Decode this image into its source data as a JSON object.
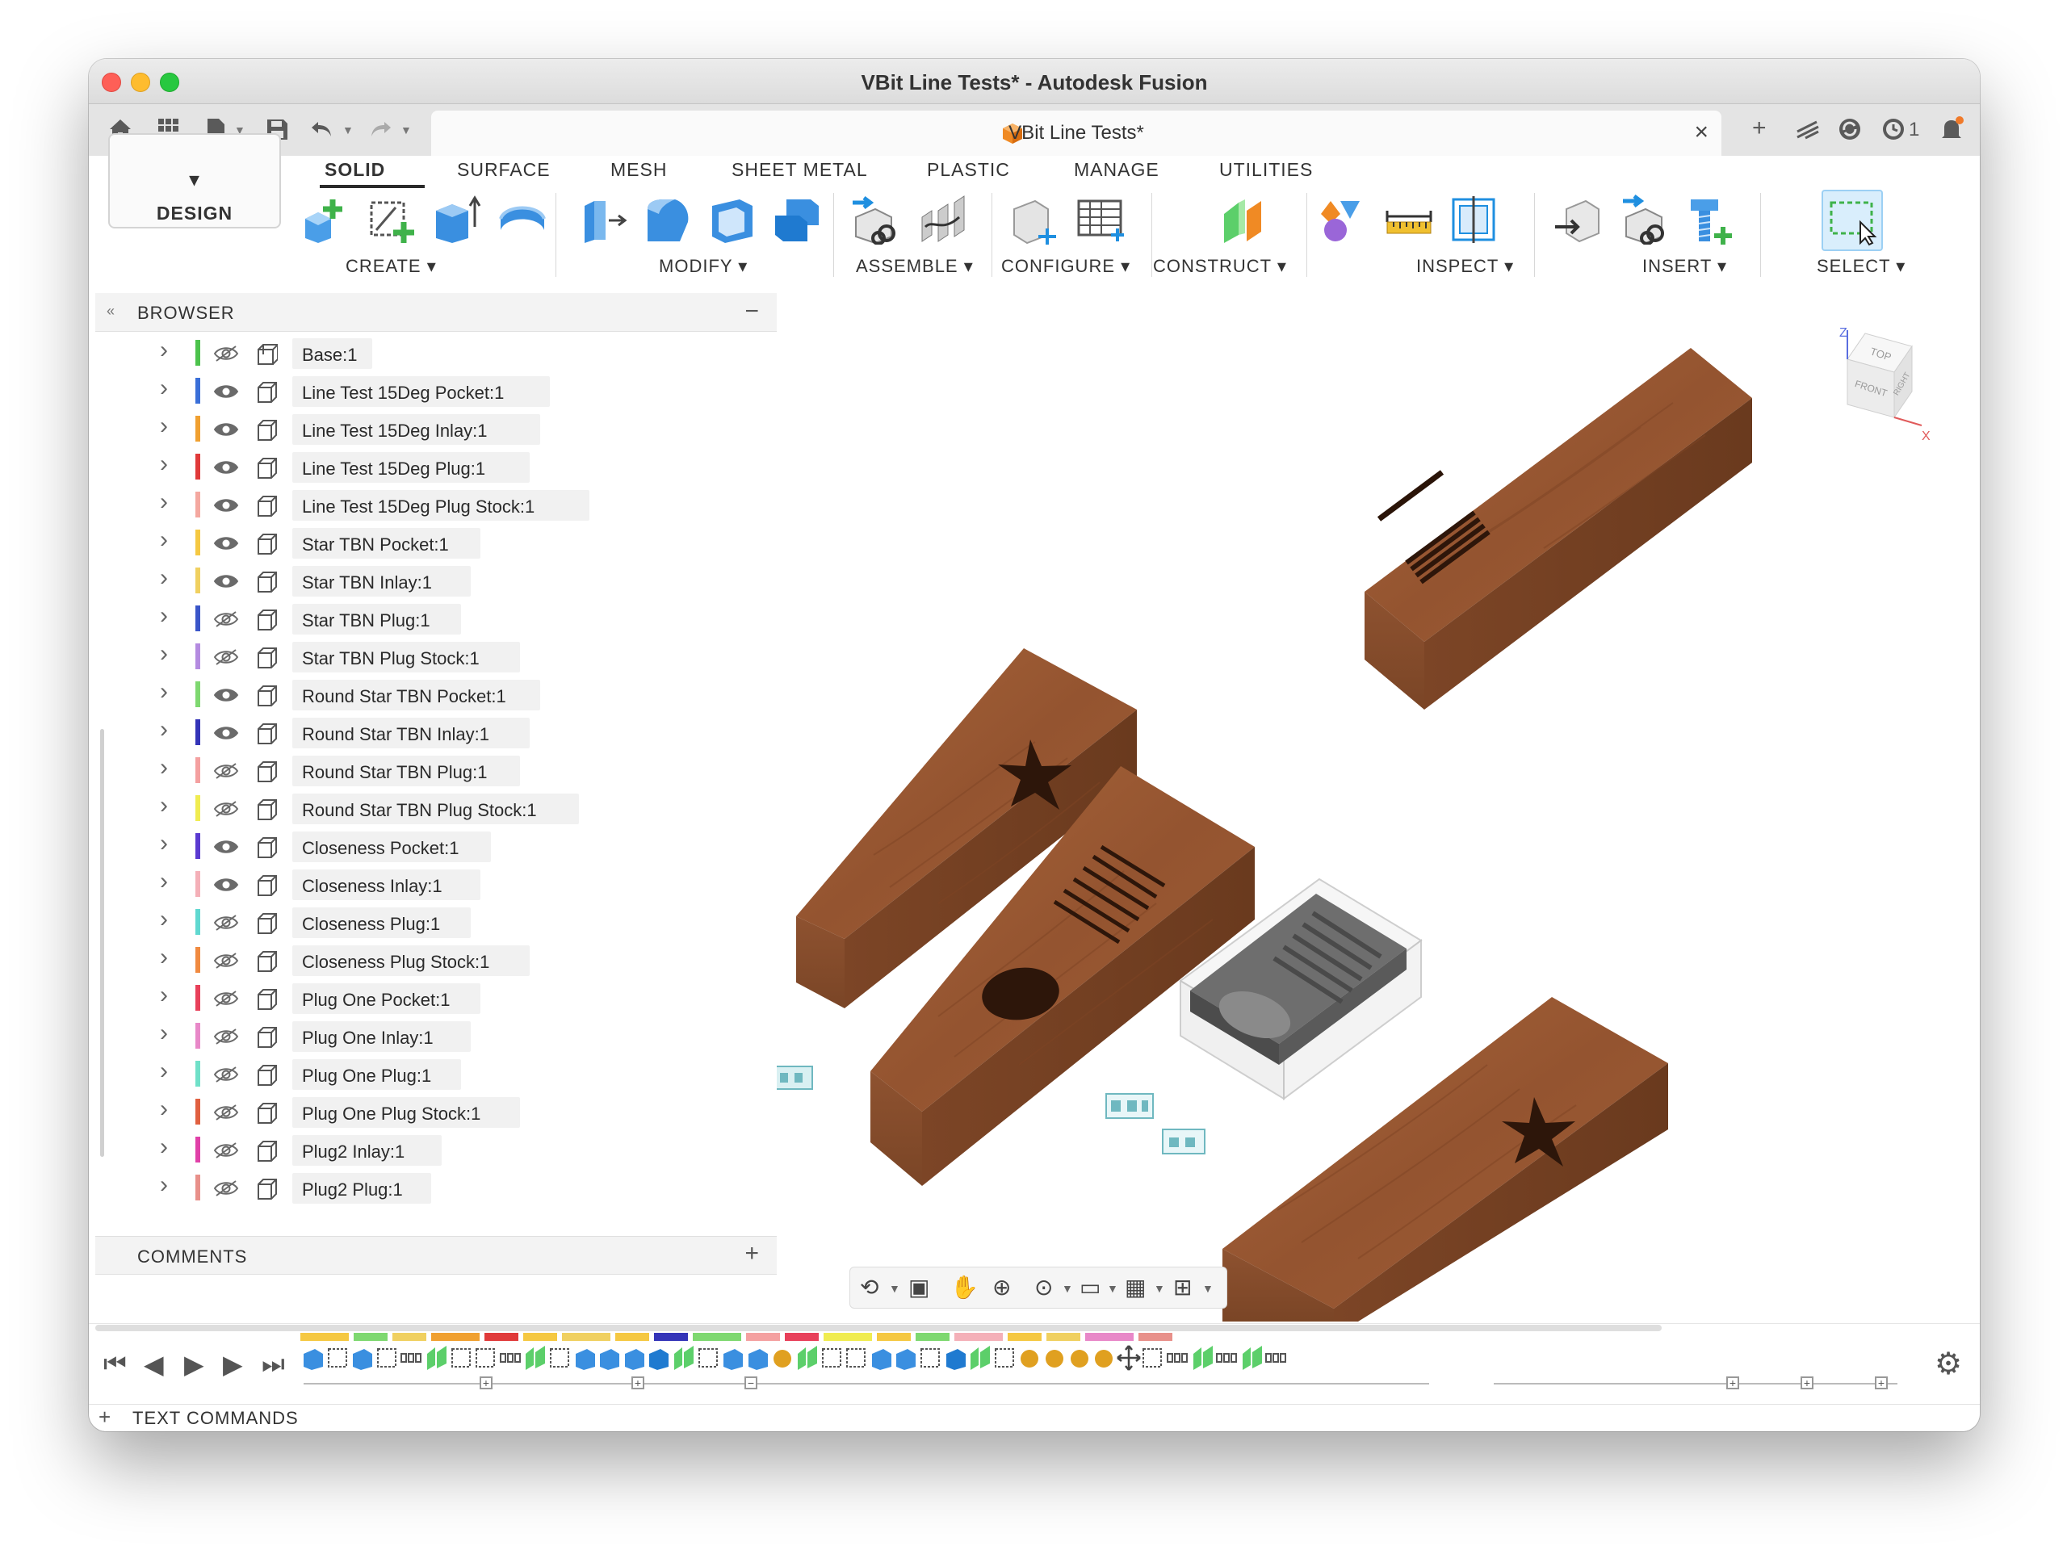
{
  "window": {
    "title": "VBit Line Tests* - Autodesk Fusion"
  },
  "quick_access": {
    "icons": [
      "home-icon",
      "grid-icon",
      "file-icon",
      "save-icon",
      "undo-icon",
      "redo-icon"
    ],
    "right_icons": [
      "plus-icon",
      "extensions-icon",
      "sync-icon",
      "clock-icon",
      "bell-icon",
      "help-icon",
      "avatar"
    ],
    "job_count": "1"
  },
  "doc_tab": {
    "label": "VBit Line Tests*",
    "close": "×"
  },
  "workspace": {
    "label": "DESIGN"
  },
  "tabs": [
    {
      "label": "SOLID",
      "active": true
    },
    {
      "label": "SURFACE"
    },
    {
      "label": "MESH"
    },
    {
      "label": "SHEET METAL"
    },
    {
      "label": "PLASTIC"
    },
    {
      "label": "MANAGE"
    },
    {
      "label": "UTILITIES"
    }
  ],
  "groups": [
    {
      "label": "CREATE",
      "icons": [
        "new-component-icon",
        "create-sketch-icon",
        "extrude-icon",
        "revolve-icon"
      ]
    },
    {
      "label": "MODIFY",
      "icons": [
        "press-pull-icon",
        "fillet-icon",
        "shell-icon",
        "combine-icon"
      ]
    },
    {
      "label": "ASSEMBLE",
      "icons": [
        "joint-icon",
        "motion-link-icon"
      ]
    },
    {
      "label": "CONFIGURE",
      "icons": [
        "configure-icon",
        "table-icon"
      ]
    },
    {
      "label": "CONSTRUCT",
      "icons": [
        "plane-icon"
      ]
    },
    {
      "label": "INSPECT",
      "icons": [
        "display-icon",
        "measure-icon",
        "section-icon"
      ]
    },
    {
      "label": "INSERT",
      "icons": [
        "insert-derive-icon",
        "insert-link-icon",
        "insert-bolt-icon"
      ]
    },
    {
      "label": "SELECT",
      "icons": [
        "window-select-icon"
      ]
    }
  ],
  "browser": {
    "title": "BROWSER",
    "collapse": "«",
    "minimize": "−",
    "items": [
      {
        "name": "Base:1",
        "color": "#4cc24c",
        "visible": false,
        "root": true
      },
      {
        "name": "Line Test 15Deg Pocket:1",
        "color": "#3a6fd8",
        "visible": true
      },
      {
        "name": "Line Test 15Deg Inlay:1",
        "color": "#f0a030",
        "visible": true
      },
      {
        "name": "Line Test 15Deg Plug:1",
        "color": "#e03a3a",
        "visible": true
      },
      {
        "name": "Line Test 15Deg Plug Stock:1",
        "color": "#f4a8a0",
        "visible": true
      },
      {
        "name": "Star TBN Pocket:1",
        "color": "#f5c842",
        "visible": true
      },
      {
        "name": "Star TBN Inlay:1",
        "color": "#f0d060",
        "visible": true
      },
      {
        "name": "Star TBN Plug:1",
        "color": "#3a55c8",
        "visible": false
      },
      {
        "name": "Star TBN Plug Stock:1",
        "color": "#b48be0",
        "visible": false
      },
      {
        "name": "Round Star TBN Pocket:1",
        "color": "#7ed870",
        "visible": true
      },
      {
        "name": "Round Star TBN Inlay:1",
        "color": "#3434b8",
        "visible": true
      },
      {
        "name": "Round Star TBN Plug:1",
        "color": "#f4a0a0",
        "visible": false
      },
      {
        "name": "Round Star TBN Plug Stock:1",
        "color": "#f0ec50",
        "visible": false
      },
      {
        "name": "Closeness Pocket:1",
        "color": "#5a3ad0",
        "visible": true
      },
      {
        "name": "Closeness Inlay:1",
        "color": "#f4b0b8",
        "visible": true
      },
      {
        "name": "Closeness Plug:1",
        "color": "#60d8d0",
        "visible": false
      },
      {
        "name": "Closeness Plug Stock:1",
        "color": "#f08a40",
        "visible": false
      },
      {
        "name": "Plug One Pocket:1",
        "color": "#e8405a",
        "visible": false
      },
      {
        "name": "Plug One Inlay:1",
        "color": "#e888c8",
        "visible": false
      },
      {
        "name": "Plug One Plug:1",
        "color": "#70e0c8",
        "visible": false
      },
      {
        "name": "Plug One Plug Stock:1",
        "color": "#e06040",
        "visible": false
      },
      {
        "name": "Plug2 Inlay:1",
        "color": "#e040a8",
        "visible": false
      },
      {
        "name": "Plug2 Plug:1",
        "color": "#e8908a",
        "visible": false
      }
    ]
  },
  "comments": {
    "title": "COMMENTS",
    "add": "+"
  },
  "viewcube": {
    "top": "TOP",
    "front": "FRONT",
    "right": "RIGHT",
    "axis_z": "Z",
    "axis_x": "X"
  },
  "nav_bar": {
    "icons": [
      "orbit-icon",
      "look-at-icon",
      "pan-icon",
      "zoom-icon",
      "fit-icon",
      "display-settings-icon",
      "grid-settings-icon",
      "viewports-icon"
    ]
  },
  "timeline": {
    "controls": [
      "go-to-start-icon",
      "step-back-icon",
      "play-icon",
      "step-forward-icon",
      "go-to-end-icon"
    ],
    "settings": "gear-icon"
  },
  "text_commands": {
    "label": "TEXT COMMANDS",
    "expand": "+"
  },
  "colors": {
    "wood": "#9b5a32",
    "wood_dark": "#6e3a1c",
    "wood_side": "#7a4424",
    "accent_blue": "#1f8fe0",
    "green_plus": "#3fb24a"
  }
}
